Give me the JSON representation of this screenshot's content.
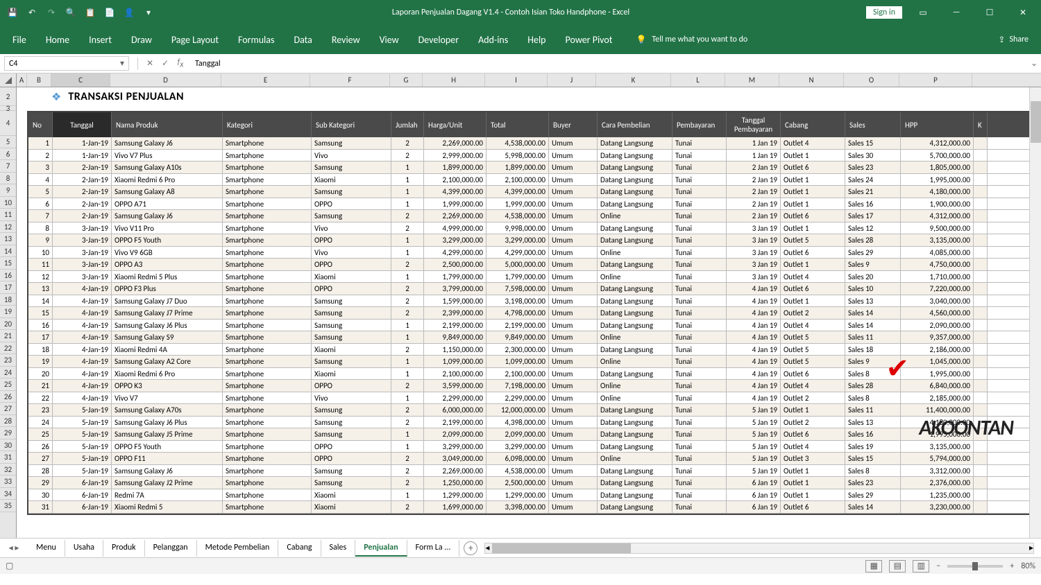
{
  "app": {
    "title": "Laporan Penjualan Dagang V1.4 - Contoh Isian Toko Handphone  -  Excel",
    "signin": "Sign in",
    "share": "Share",
    "tellme": "Tell me what you want to do"
  },
  "ribbon": {
    "file": "File",
    "tabs": [
      "Home",
      "Insert",
      "Draw",
      "Page Layout",
      "Formulas",
      "Data",
      "Review",
      "View",
      "Developer",
      "Add-ins",
      "Help",
      "Power Pivot"
    ]
  },
  "formula_bar": {
    "name_box": "C4",
    "formula": "Tanggal"
  },
  "columns": [
    "A",
    "B",
    "C",
    "D",
    "E",
    "F",
    "G",
    "H",
    "I",
    "J",
    "K",
    "L",
    "M",
    "N",
    "O",
    "P"
  ],
  "sheet": {
    "title": "TRANSAKSI PENJUALAN",
    "headers": {
      "no": "No",
      "tanggal": "Tanggal",
      "nama": "Nama Produk",
      "kategori": "Kategori",
      "sub": "Sub Kategori",
      "jumlah": "Jumlah",
      "harga": "Harga/Unit",
      "total": "Total",
      "buyer": "Buyer",
      "cara": "Cara Pembelian",
      "bayar": "Pembayaran",
      "tglbayar": "Tanggal Pembayaran",
      "cabang": "Cabang",
      "sales": "Sales",
      "hpp": "HPP",
      "k": "K"
    },
    "rows": [
      {
        "n": "1",
        "tgl": "1-Jan-19",
        "nama": "Samsung Galaxy J6",
        "kat": "Smartphone",
        "sub": "Samsung",
        "jml": "2",
        "harga": "2,269,000.00",
        "tot": "4,538,000.00",
        "buy": "Umum",
        "cara": "Datang Langsung",
        "bay": "Tunai",
        "tb": "1 Jan 19",
        "cab": "Outlet 4",
        "sal": "Sales 15",
        "hpp": "4,312,000.00"
      },
      {
        "n": "2",
        "tgl": "1-Jan-19",
        "nama": "Vivo V7 Plus",
        "kat": "Smartphone",
        "sub": "Vivo",
        "jml": "2",
        "harga": "2,999,000.00",
        "tot": "5,998,000.00",
        "buy": "Umum",
        "cara": "Datang Langsung",
        "bay": "Tunai",
        "tb": "1 Jan 19",
        "cab": "Outlet 1",
        "sal": "Sales 30",
        "hpp": "5,700,000.00"
      },
      {
        "n": "3",
        "tgl": "2-Jan-19",
        "nama": "Samsung Galaxy A10s",
        "kat": "Smartphone",
        "sub": "Samsung",
        "jml": "1",
        "harga": "1,899,000.00",
        "tot": "1,899,000.00",
        "buy": "Umum",
        "cara": "Datang Langsung",
        "bay": "Tunai",
        "tb": "2 Jan 19",
        "cab": "Outlet 6",
        "sal": "Sales 23",
        "hpp": "1,805,000.00"
      },
      {
        "n": "4",
        "tgl": "2-Jan-19",
        "nama": "Xiaomi Redmi 6 Pro",
        "kat": "Smartphone",
        "sub": "Xiaomi",
        "jml": "1",
        "harga": "2,100,000.00",
        "tot": "2,100,000.00",
        "buy": "Umum",
        "cara": "Datang Langsung",
        "bay": "Tunai",
        "tb": "2 Jan 19",
        "cab": "Outlet 1",
        "sal": "Sales 24",
        "hpp": "1,995,000.00"
      },
      {
        "n": "5",
        "tgl": "2-Jan-19",
        "nama": "Samsung Galaxy A8",
        "kat": "Smartphone",
        "sub": "Samsung",
        "jml": "1",
        "harga": "4,399,000.00",
        "tot": "4,399,000.00",
        "buy": "Umum",
        "cara": "Datang Langsung",
        "bay": "Tunai",
        "tb": "2 Jan 19",
        "cab": "Outlet 1",
        "sal": "Sales 21",
        "hpp": "4,180,000.00"
      },
      {
        "n": "6",
        "tgl": "2-Jan-19",
        "nama": "OPPO A71",
        "kat": "Smartphone",
        "sub": "OPPO",
        "jml": "1",
        "harga": "1,999,000.00",
        "tot": "1,999,000.00",
        "buy": "Umum",
        "cara": "Datang Langsung",
        "bay": "Tunai",
        "tb": "2 Jan 19",
        "cab": "Outlet 1",
        "sal": "Sales 16",
        "hpp": "1,900,000.00"
      },
      {
        "n": "7",
        "tgl": "2-Jan-19",
        "nama": "Samsung Galaxy J6",
        "kat": "Smartphone",
        "sub": "Samsung",
        "jml": "2",
        "harga": "2,269,000.00",
        "tot": "4,538,000.00",
        "buy": "Umum",
        "cara": "Online",
        "bay": "Tunai",
        "tb": "2 Jan 19",
        "cab": "Outlet 6",
        "sal": "Sales 17",
        "hpp": "4,312,000.00"
      },
      {
        "n": "8",
        "tgl": "3-Jan-19",
        "nama": "Vivo V11 Pro",
        "kat": "Smartphone",
        "sub": "Vivo",
        "jml": "2",
        "harga": "4,999,000.00",
        "tot": "9,998,000.00",
        "buy": "Umum",
        "cara": "Datang Langsung",
        "bay": "Tunai",
        "tb": "3 Jan 19",
        "cab": "Outlet 1",
        "sal": "Sales 12",
        "hpp": "9,500,000.00"
      },
      {
        "n": "9",
        "tgl": "3-Jan-19",
        "nama": "OPPO F5 Youth",
        "kat": "Smartphone",
        "sub": "OPPO",
        "jml": "1",
        "harga": "3,299,000.00",
        "tot": "3,299,000.00",
        "buy": "Umum",
        "cara": "Datang Langsung",
        "bay": "Tunai",
        "tb": "3 Jan 19",
        "cab": "Outlet 5",
        "sal": "Sales 28",
        "hpp": "3,135,000.00"
      },
      {
        "n": "10",
        "tgl": "3-Jan-19",
        "nama": "Vivo V9 6GB",
        "kat": "Smartphone",
        "sub": "Vivo",
        "jml": "1",
        "harga": "4,299,000.00",
        "tot": "4,299,000.00",
        "buy": "Umum",
        "cara": "Online",
        "bay": "Tunai",
        "tb": "3 Jan 19",
        "cab": "Outlet 6",
        "sal": "Sales 29",
        "hpp": "4,085,000.00"
      },
      {
        "n": "11",
        "tgl": "3-Jan-19",
        "nama": "OPPO A3",
        "kat": "Smartphone",
        "sub": "OPPO",
        "jml": "2",
        "harga": "2,500,000.00",
        "tot": "5,000,000.00",
        "buy": "Umum",
        "cara": "Datang Langsung",
        "bay": "Tunai",
        "tb": "3 Jan 19",
        "cab": "Outlet 1",
        "sal": "Sales 9",
        "hpp": "4,750,000.00"
      },
      {
        "n": "12",
        "tgl": "3-Jan-19",
        "nama": "Xiaomi Redmi 5 Plus",
        "kat": "Smartphone",
        "sub": "Xiaomi",
        "jml": "1",
        "harga": "1,799,000.00",
        "tot": "1,799,000.00",
        "buy": "Umum",
        "cara": "Online",
        "bay": "Tunai",
        "tb": "3 Jan 19",
        "cab": "Outlet 4",
        "sal": "Sales 20",
        "hpp": "1,710,000.00"
      },
      {
        "n": "13",
        "tgl": "4-Jan-19",
        "nama": "OPPO F3 Plus",
        "kat": "Smartphone",
        "sub": "OPPO",
        "jml": "2",
        "harga": "3,799,000.00",
        "tot": "7,598,000.00",
        "buy": "Umum",
        "cara": "Datang Langsung",
        "bay": "Tunai",
        "tb": "4 Jan 19",
        "cab": "Outlet 6",
        "sal": "Sales 10",
        "hpp": "7,220,000.00"
      },
      {
        "n": "14",
        "tgl": "4-Jan-19",
        "nama": "Samsung Galaxy J7 Duo",
        "kat": "Smartphone",
        "sub": "Samsung",
        "jml": "2",
        "harga": "1,599,000.00",
        "tot": "3,198,000.00",
        "buy": "Umum",
        "cara": "Datang Langsung",
        "bay": "Tunai",
        "tb": "4 Jan 19",
        "cab": "Outlet 1",
        "sal": "Sales 13",
        "hpp": "3,040,000.00"
      },
      {
        "n": "15",
        "tgl": "4-Jan-19",
        "nama": "Samsung Galaxy J7 Prime",
        "kat": "Smartphone",
        "sub": "Samsung",
        "jml": "2",
        "harga": "2,399,000.00",
        "tot": "4,798,000.00",
        "buy": "Umum",
        "cara": "Datang Langsung",
        "bay": "Tunai",
        "tb": "4 Jan 19",
        "cab": "Outlet 2",
        "sal": "Sales 14",
        "hpp": "4,560,000.00"
      },
      {
        "n": "16",
        "tgl": "4-Jan-19",
        "nama": "Samsung Galaxy J6 Plus",
        "kat": "Smartphone",
        "sub": "Samsung",
        "jml": "1",
        "harga": "2,199,000.00",
        "tot": "2,199,000.00",
        "buy": "Umum",
        "cara": "Datang Langsung",
        "bay": "Tunai",
        "tb": "4 Jan 19",
        "cab": "Outlet 4",
        "sal": "Sales 14",
        "hpp": "2,090,000.00"
      },
      {
        "n": "17",
        "tgl": "4-Jan-19",
        "nama": "Samsung Galaxy S9",
        "kat": "Smartphone",
        "sub": "Samsung",
        "jml": "1",
        "harga": "9,849,000.00",
        "tot": "9,849,000.00",
        "buy": "Umum",
        "cara": "Online",
        "bay": "Tunai",
        "tb": "4 Jan 19",
        "cab": "Outlet 5",
        "sal": "Sales 11",
        "hpp": "9,357,000.00"
      },
      {
        "n": "18",
        "tgl": "4-Jan-19",
        "nama": "Xiaomi Redmi 4A",
        "kat": "Smartphone",
        "sub": "Xiaomi",
        "jml": "2",
        "harga": "1,150,000.00",
        "tot": "2,300,000.00",
        "buy": "Umum",
        "cara": "Datang Langsung",
        "bay": "Tunai",
        "tb": "4 Jan 19",
        "cab": "Outlet 5",
        "sal": "Sales 18",
        "hpp": "2,186,000.00"
      },
      {
        "n": "19",
        "tgl": "4-Jan-19",
        "nama": "Samsung Galaxy A2 Core",
        "kat": "Smartphone",
        "sub": "Samsung",
        "jml": "1",
        "harga": "1,099,000.00",
        "tot": "1,099,000.00",
        "buy": "Umum",
        "cara": "Online",
        "bay": "Tunai",
        "tb": "4 Jan 19",
        "cab": "Outlet 5",
        "sal": "Sales 9",
        "hpp": "1,045,000.00"
      },
      {
        "n": "20",
        "tgl": "4-Jan-19",
        "nama": "Xiaomi Redmi 6 Pro",
        "kat": "Smartphone",
        "sub": "Xiaomi",
        "jml": "1",
        "harga": "2,100,000.00",
        "tot": "2,100,000.00",
        "buy": "Umum",
        "cara": "Datang Langsung",
        "bay": "Tunai",
        "tb": "4 Jan 19",
        "cab": "Outlet 6",
        "sal": "Sales 8",
        "hpp": "1,995,000.00"
      },
      {
        "n": "21",
        "tgl": "4-Jan-19",
        "nama": "OPPO K3",
        "kat": "Smartphone",
        "sub": "OPPO",
        "jml": "2",
        "harga": "3,599,000.00",
        "tot": "7,198,000.00",
        "buy": "Umum",
        "cara": "Online",
        "bay": "Tunai",
        "tb": "4 Jan 19",
        "cab": "Outlet 4",
        "sal": "Sales 28",
        "hpp": "6,840,000.00"
      },
      {
        "n": "22",
        "tgl": "4-Jan-19",
        "nama": "Vivo V7",
        "kat": "Smartphone",
        "sub": "Vivo",
        "jml": "1",
        "harga": "2,299,000.00",
        "tot": "2,299,000.00",
        "buy": "Umum",
        "cara": "Online",
        "bay": "Tunai",
        "tb": "4 Jan 19",
        "cab": "Outlet 2",
        "sal": "Sales 8",
        "hpp": "2,185,000.00"
      },
      {
        "n": "23",
        "tgl": "5-Jan-19",
        "nama": "Samsung Galaxy A70s",
        "kat": "Smartphone",
        "sub": "Samsung",
        "jml": "2",
        "harga": "6,000,000.00",
        "tot": "12,000,000.00",
        "buy": "Umum",
        "cara": "Datang Langsung",
        "bay": "Tunai",
        "tb": "5 Jan 19",
        "cab": "Outlet 1",
        "sal": "Sales 11",
        "hpp": "11,400,000.00"
      },
      {
        "n": "24",
        "tgl": "5-Jan-19",
        "nama": "Samsung Galaxy J6 Plus",
        "kat": "Smartphone",
        "sub": "Samsung",
        "jml": "2",
        "harga": "2,199,000.00",
        "tot": "4,398,000.00",
        "buy": "Umum",
        "cara": "Datang Langsung",
        "bay": "Tunai",
        "tb": "5 Jan 19",
        "cab": "Outlet 2",
        "sal": "Sales 13",
        "hpp": "4,180,000.00"
      },
      {
        "n": "25",
        "tgl": "5-Jan-19",
        "nama": "Samsung Galaxy J5 Prime",
        "kat": "Smartphone",
        "sub": "Samsung",
        "jml": "1",
        "harga": "2,099,000.00",
        "tot": "2,099,000.00",
        "buy": "Umum",
        "cara": "Datang Langsung",
        "bay": "Tunai",
        "tb": "5 Jan 19",
        "cab": "Outlet 6",
        "sal": "Sales 16",
        "hpp": "1,995,000.00"
      },
      {
        "n": "26",
        "tgl": "5-Jan-19",
        "nama": "OPPO F5 Youth",
        "kat": "Smartphone",
        "sub": "OPPO",
        "jml": "1",
        "harga": "3,299,000.00",
        "tot": "3,299,000.00",
        "buy": "Umum",
        "cara": "Datang Langsung",
        "bay": "Tunai",
        "tb": "5 Jan 19",
        "cab": "Outlet 4",
        "sal": "Sales 19",
        "hpp": "3,135,000.00"
      },
      {
        "n": "27",
        "tgl": "5-Jan-19",
        "nama": "OPPO F11",
        "kat": "Smartphone",
        "sub": "OPPO",
        "jml": "2",
        "harga": "3,049,000.00",
        "tot": "6,098,000.00",
        "buy": "Umum",
        "cara": "Online",
        "bay": "Tunai",
        "tb": "5 Jan 19",
        "cab": "Outlet 3",
        "sal": "Sales 15",
        "hpp": "5,794,000.00"
      },
      {
        "n": "28",
        "tgl": "5-Jan-19",
        "nama": "Samsung Galaxy J6",
        "kat": "Smartphone",
        "sub": "Samsung",
        "jml": "2",
        "harga": "2,269,000.00",
        "tot": "4,538,000.00",
        "buy": "Umum",
        "cara": "Datang Langsung",
        "bay": "Tunai",
        "tb": "5 Jan 19",
        "cab": "Outlet 1",
        "sal": "Sales 8",
        "hpp": "3,312,000.00"
      },
      {
        "n": "29",
        "tgl": "6-Jan-19",
        "nama": "Samsung Galaxy J2 Prime",
        "kat": "Smartphone",
        "sub": "Samsung",
        "jml": "2",
        "harga": "1,250,000.00",
        "tot": "2,500,000.00",
        "buy": "Umum",
        "cara": "Datang Langsung",
        "bay": "Tunai",
        "tb": "6 Jan 19",
        "cab": "Outlet 1",
        "sal": "Sales 23",
        "hpp": "2,376,000.00"
      },
      {
        "n": "30",
        "tgl": "6-Jan-19",
        "nama": "Redmi 7A",
        "kat": "Smartphone",
        "sub": "Xiaomi",
        "jml": "1",
        "harga": "1,299,000.00",
        "tot": "1,299,000.00",
        "buy": "Umum",
        "cara": "Datang Langsung",
        "bay": "Tunai",
        "tb": "6 Jan 19",
        "cab": "Outlet 1",
        "sal": "Sales 29",
        "hpp": "1,235,000.00"
      },
      {
        "n": "31",
        "tgl": "6-Jan-19",
        "nama": "Xiaomi Redmi 5",
        "kat": "Smartphone",
        "sub": "Xiaomi",
        "jml": "2",
        "harga": "1,699,000.00",
        "tot": "3,398,000.00",
        "buy": "Umum",
        "cara": "Datang Langsung",
        "bay": "Tunai",
        "tb": "6 Jan 19",
        "cab": "Outlet 6",
        "sal": "Sales 14",
        "hpp": "3,230,000.00"
      }
    ]
  },
  "tabs": [
    "Menu",
    "Usaha",
    "Produk",
    "Pelanggan",
    "Metode Pembelian",
    "Cabang",
    "Sales",
    "Penjualan",
    "Form La  ..."
  ],
  "tabs_active": "Penjualan",
  "status": {
    "zoom": "80%"
  },
  "row_numbers": [
    "2",
    "3",
    "4",
    "5",
    "6",
    "7",
    "8",
    "9",
    "10",
    "11",
    "12",
    "13",
    "14",
    "15",
    "16",
    "17",
    "18",
    "19",
    "20",
    "21",
    "22",
    "23",
    "24",
    "25",
    "26",
    "27",
    "28",
    "29",
    "30",
    "31",
    "32",
    "33",
    "34",
    "35"
  ]
}
